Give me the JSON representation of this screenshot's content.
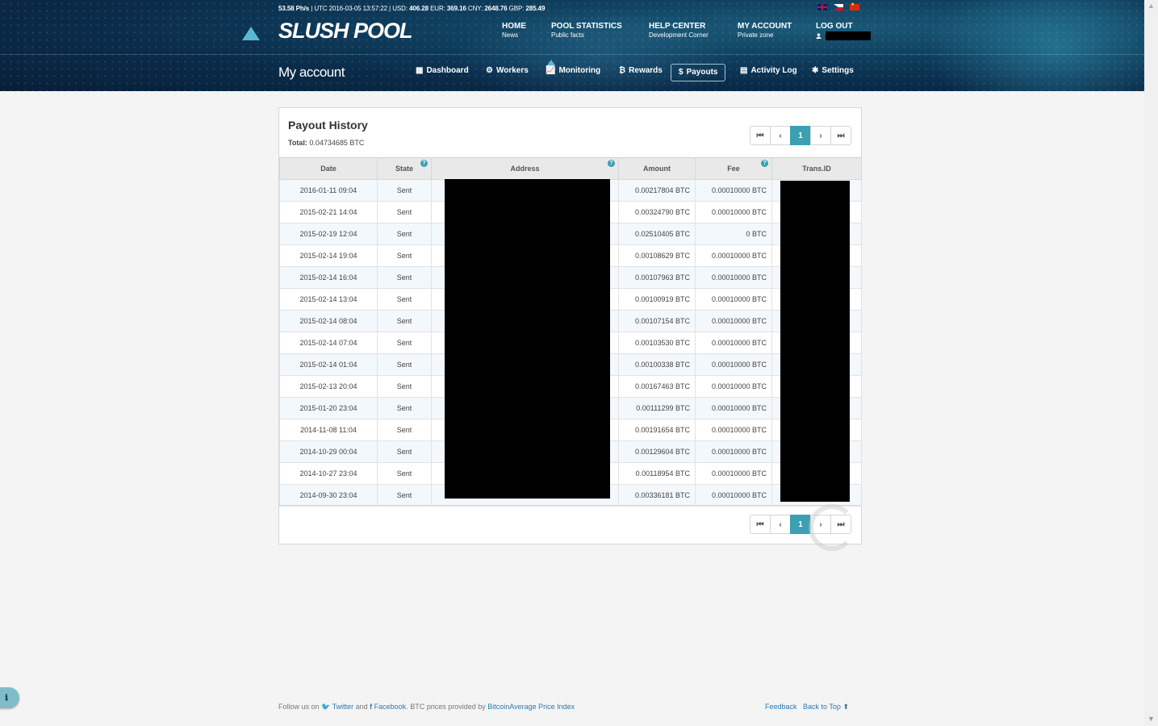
{
  "ticker": {
    "hashrate": "53.58 Ph/s",
    "utc_label": "| UTC 2016-03-05 13:57:22 | USD: ",
    "usd": "406.28",
    "eur_label": " EUR: ",
    "eur": "369.16",
    "cny_label": " CNY: ",
    "cny": "2648.76",
    "gbp_label": " GBP: ",
    "gbp": "285.49"
  },
  "logo": "SLUSH POOL",
  "top_nav": {
    "home": {
      "title": "HOME",
      "sub": "News"
    },
    "stats": {
      "title": "POOL STATISTICS",
      "sub": "Public facts"
    },
    "help": {
      "title": "HELP CENTER",
      "sub": "Development Corner"
    },
    "account": {
      "title": "MY ACCOUNT",
      "sub": "Private zone"
    },
    "logout": {
      "title": "LOG OUT",
      "user_icon": "user-icon"
    }
  },
  "page_title": "My account",
  "sub_nav": {
    "dashboard": {
      "label": "Dashboard",
      "icon": "grid-icon"
    },
    "workers": {
      "label": "Workers",
      "icon": "cogs-icon"
    },
    "monitoring": {
      "label": "Monitoring",
      "icon": "chart-icon"
    },
    "rewards": {
      "label": "Rewards",
      "icon": "bitcoin-icon"
    },
    "payouts": {
      "label": "Payouts",
      "icon": "dollar-icon"
    },
    "activity": {
      "label": "Activity Log",
      "icon": "book-icon"
    },
    "settings": {
      "label": "Settings",
      "icon": "gear-icon"
    }
  },
  "panel": {
    "title": "Payout History",
    "total_label": "Total:",
    "total_value": "0.04734685 BTC",
    "current_page": "1"
  },
  "table": {
    "headers": {
      "date": "Date",
      "state": "State",
      "address": "Address",
      "amount": "Amount",
      "fee": "Fee",
      "txid": "Trans.ID"
    },
    "rows": [
      {
        "date": "2016-01-11 09:04",
        "state": "Sent",
        "amount": "0.00217804 BTC",
        "fee": "0.00010000 BTC"
      },
      {
        "date": "2015-02-21 14:04",
        "state": "Sent",
        "amount": "0.00324790 BTC",
        "fee": "0.00010000 BTC"
      },
      {
        "date": "2015-02-19 12:04",
        "state": "Sent",
        "amount": "0.02510405 BTC",
        "fee": "0 BTC"
      },
      {
        "date": "2015-02-14 19:04",
        "state": "Sent",
        "amount": "0.00108629 BTC",
        "fee": "0.00010000 BTC"
      },
      {
        "date": "2015-02-14 16:04",
        "state": "Sent",
        "amount": "0.00107963 BTC",
        "fee": "0.00010000 BTC"
      },
      {
        "date": "2015-02-14 13:04",
        "state": "Sent",
        "amount": "0.00100919 BTC",
        "fee": "0.00010000 BTC"
      },
      {
        "date": "2015-02-14 08:04",
        "state": "Sent",
        "amount": "0.00107154 BTC",
        "fee": "0.00010000 BTC"
      },
      {
        "date": "2015-02-14 07:04",
        "state": "Sent",
        "amount": "0.00103530 BTC",
        "fee": "0.00010000 BTC"
      },
      {
        "date": "2015-02-14 01:04",
        "state": "Sent",
        "amount": "0.00100338 BTC",
        "fee": "0.00010000 BTC"
      },
      {
        "date": "2015-02-13 20:04",
        "state": "Sent",
        "amount": "0.00167463 BTC",
        "fee": "0.00010000 BTC"
      },
      {
        "date": "2015-01-20 23:04",
        "state": "Sent",
        "amount": "0.00111299 BTC",
        "fee": "0.00010000 BTC"
      },
      {
        "date": "2014-11-08 11:04",
        "state": "Sent",
        "amount": "0.00191654 BTC",
        "fee": "0.00010000 BTC"
      },
      {
        "date": "2014-10-29 00:04",
        "state": "Sent",
        "amount": "0.00129604 BTC",
        "fee": "0.00010000 BTC"
      },
      {
        "date": "2014-10-27 23:04",
        "state": "Sent",
        "amount": "0.00118954 BTC",
        "fee": "0.00010000 BTC"
      },
      {
        "date": "2014-09-30 23:04",
        "state": "Sent",
        "amount": "0.00336181 BTC",
        "fee": "0.00010000 BTC"
      }
    ]
  },
  "footer": {
    "follow": "Follow us on ",
    "twitter": "Twitter",
    "and": " and ",
    "facebook": "Facebook",
    "prices": ". BTC prices provided by ",
    "bitcoinaverage": "BitcoinAverage Price Index",
    "feedback": "Feedback",
    "back_to_top": "Back to Top"
  },
  "colors": {
    "accent": "#3aa0b2",
    "header_dark": "#0a2a48",
    "link": "#2a7ab0"
  }
}
